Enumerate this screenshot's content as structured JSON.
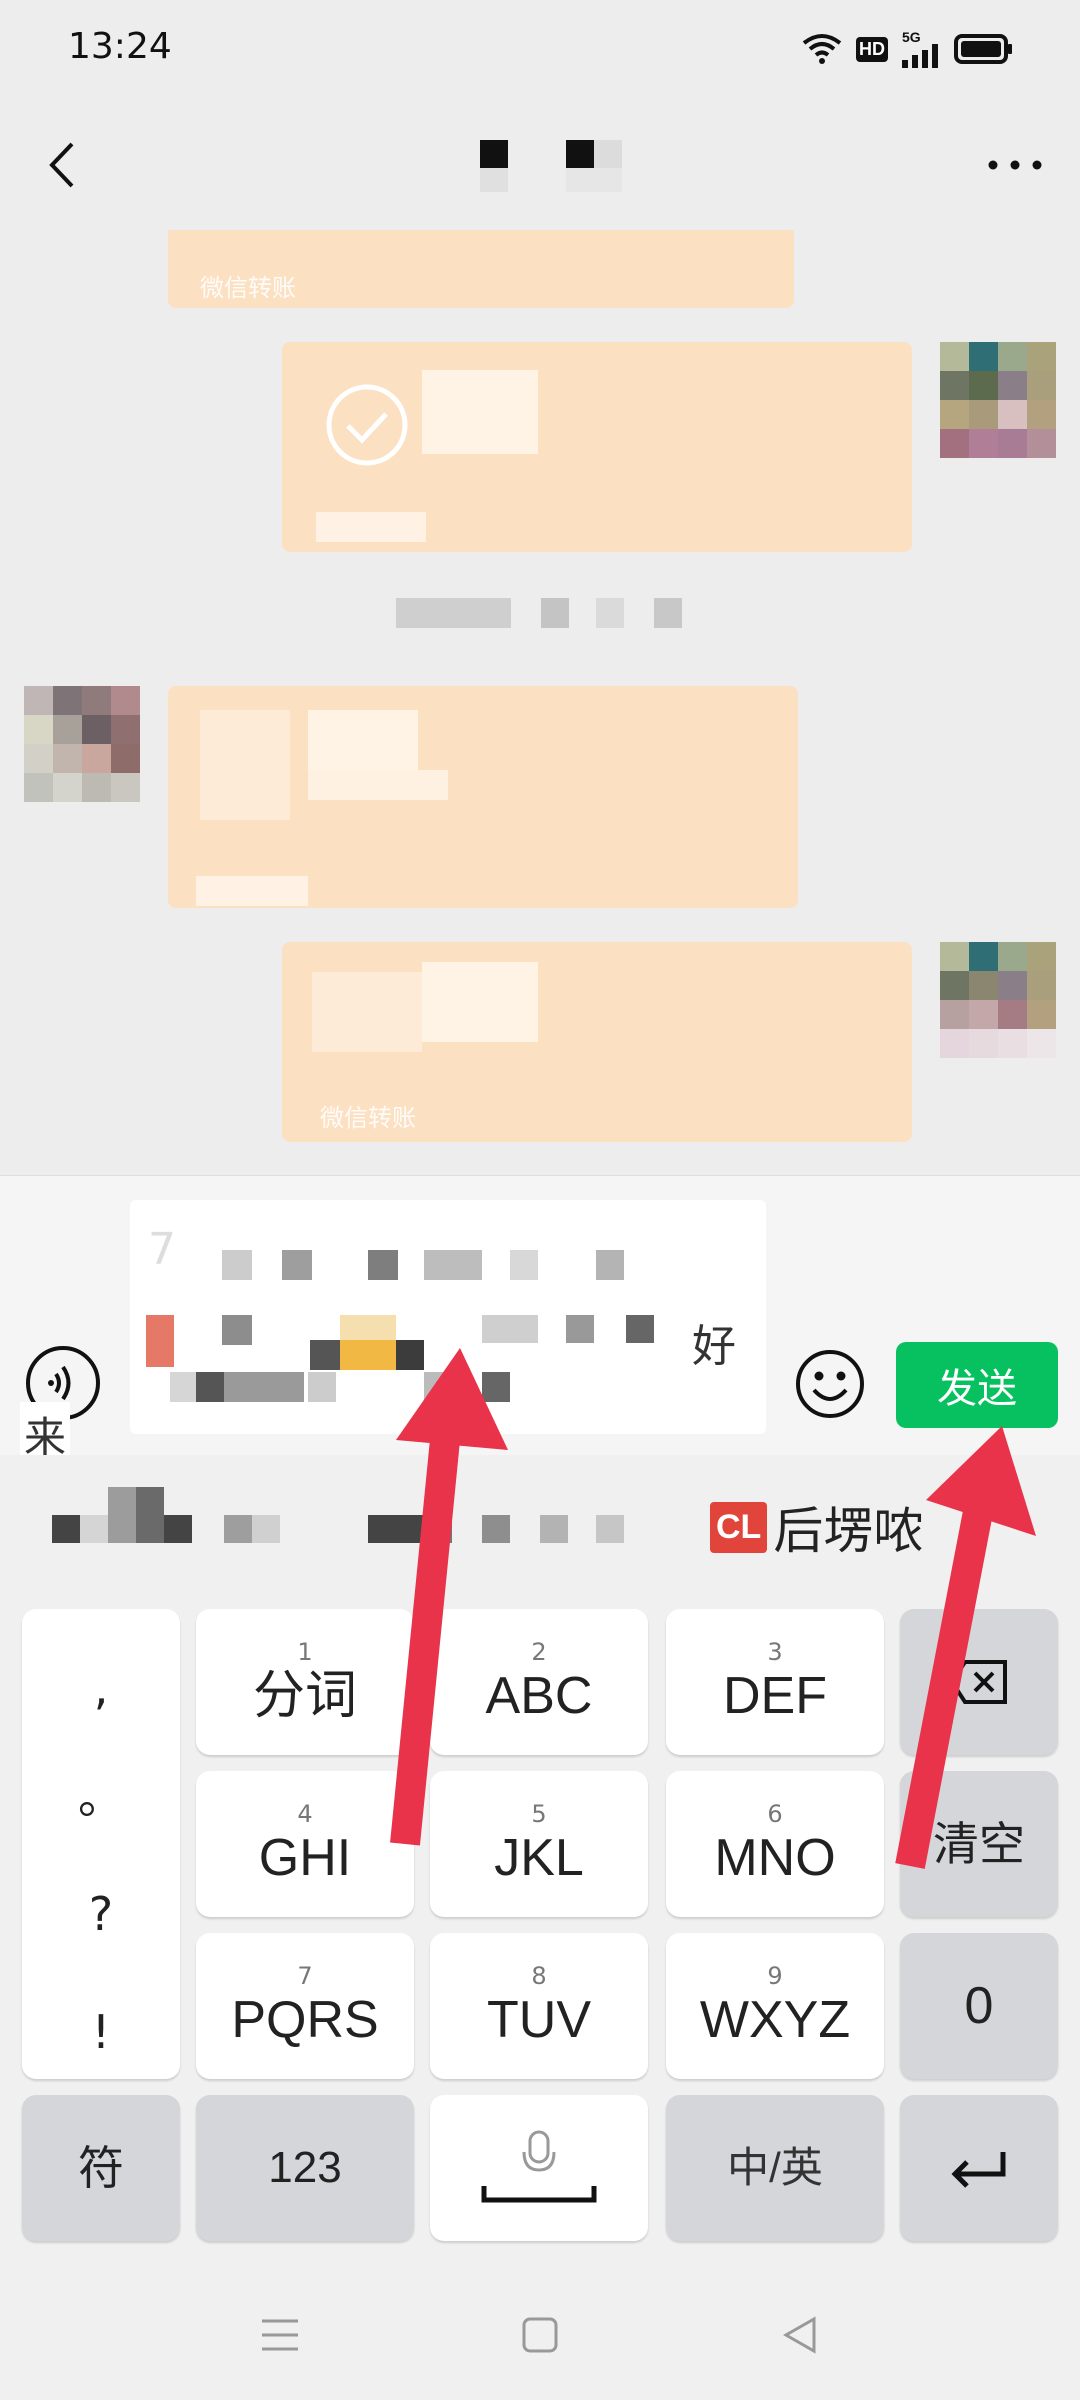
{
  "status_bar": {
    "time": "13:24",
    "icons": [
      "wifi-icon",
      "hd-icon",
      "signal-5g-icon",
      "battery-icon"
    ],
    "hd_label": "HD",
    "network_label": "5G"
  },
  "title_bar": {
    "back_icon": "chevron-left-icon",
    "more_icon": "more-dots-icon"
  },
  "chat": {
    "messages": [
      {
        "side": "left",
        "caption": "微信转账"
      },
      {
        "side": "right",
        "caption": ""
      },
      {
        "side": "center",
        "caption": ""
      },
      {
        "side": "left",
        "caption": ""
      },
      {
        "side": "right",
        "caption": "微信转账"
      }
    ]
  },
  "input_bar": {
    "candidate_tail": "好",
    "candidate_first_char": "7",
    "lai_label": "来",
    "send_label": "发送",
    "voice_icon": "voice-icon",
    "emoji_icon": "emoji-icon"
  },
  "suggestion": {
    "badge": "CL",
    "word": "后塄哝"
  },
  "keyboard": {
    "punct": [
      ",",
      "。",
      "?",
      "!"
    ],
    "keys": [
      {
        "num": "1",
        "label": "分词"
      },
      {
        "num": "2",
        "label": "ABC"
      },
      {
        "num": "3",
        "label": "DEF"
      },
      {
        "num": "4",
        "label": "GHI"
      },
      {
        "num": "5",
        "label": "JKL"
      },
      {
        "num": "6",
        "label": "MNO"
      },
      {
        "num": "7",
        "label": "PQRS"
      },
      {
        "num": "8",
        "label": "TUV"
      },
      {
        "num": "9",
        "label": "WXYZ"
      }
    ],
    "side": {
      "backspace_icon": "backspace-icon",
      "clear_label": "清空",
      "zero_label": "0",
      "enter_icon": "enter-icon"
    },
    "bottom": {
      "symbol_label": "符",
      "numeric_label": "123",
      "space_icon": "microphone-icon",
      "lang_label": "中/英"
    }
  },
  "nav_bar": {
    "icons": [
      "menu-icon",
      "home-icon",
      "back-triangle-icon"
    ]
  },
  "colors": {
    "background": "#ededed",
    "bubble": "#fce0c2",
    "send_button": "#07c160",
    "arrow": "#e8334a"
  }
}
